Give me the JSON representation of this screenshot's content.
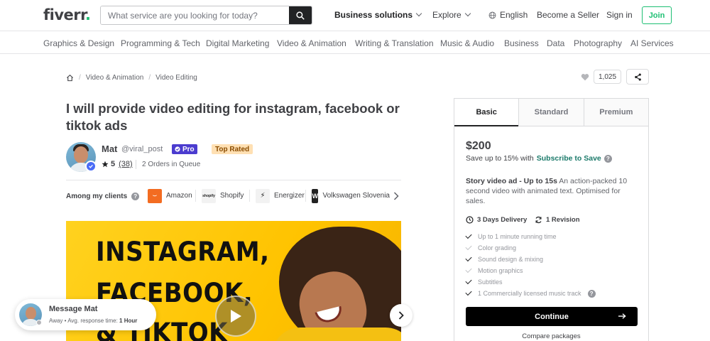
{
  "header": {
    "logo": "fiverr",
    "logo_dot": ".",
    "search_placeholder": "What service are you looking for today?",
    "business_solutions": "Business solutions",
    "explore": "Explore",
    "language": "English",
    "become_seller": "Become a Seller",
    "sign_in": "Sign in",
    "join": "Join"
  },
  "categories": [
    "Graphics & Design",
    "Programming & Tech",
    "Digital Marketing",
    "Video & Animation",
    "Writing & Translation",
    "Music & Audio",
    "Business",
    "Data",
    "Photography",
    "AI Services"
  ],
  "breadcrumb": [
    "Video & Animation",
    "Video Editing"
  ],
  "likes_count": "1,025",
  "gig": {
    "title": "I will provide video editing for instagram, facebook or tiktok ads",
    "seller_name": "Mat",
    "seller_handle": "@viral_post",
    "pro_label": "Pro",
    "top_rated_label": "Top Rated",
    "rating": "5",
    "reviews": "(38)",
    "orders_queue": "2 Orders in Queue",
    "clients_label": "Among my clients",
    "clients": [
      "Amazon",
      "Shopify",
      "Energizer",
      "Volkswagen Slovenia"
    ],
    "hero_lines": [
      "INSTAGRAM,",
      "FACEBOOK,",
      "& TIKTOK"
    ]
  },
  "message_widget": {
    "title": "Message Mat",
    "status": "Away",
    "response_label": "Avg. response time:",
    "response_time": "1 Hour"
  },
  "package": {
    "tabs": [
      "Basic",
      "Standard",
      "Premium"
    ],
    "price": "$200",
    "save_text": "Save up to 15% with",
    "subscribe_text": "Subscribe to Save",
    "desc_title": "Story video ad - Up to 15s",
    "desc_body": "An action-packed 10 second video with animated text. Optimised for sales.",
    "delivery": "3 Days Delivery",
    "revisions": "1 Revision",
    "features": [
      {
        "label": "Up to 1 minute running time",
        "included": true
      },
      {
        "label": "Color grading",
        "included": false
      },
      {
        "label": "Sound design & mixing",
        "included": true
      },
      {
        "label": "Motion graphics",
        "included": false
      },
      {
        "label": "Subtitles",
        "included": true
      },
      {
        "label": "1 Commercially licensed music track",
        "included": true
      }
    ],
    "continue_label": "Continue",
    "compare_label": "Compare packages"
  },
  "colors": {
    "brand_green": "#1dbf73",
    "pro_badge": "#4b3ccf",
    "top_rated_bg": "#ffe0b3",
    "subscribe_teal": "#1b7a6a"
  }
}
